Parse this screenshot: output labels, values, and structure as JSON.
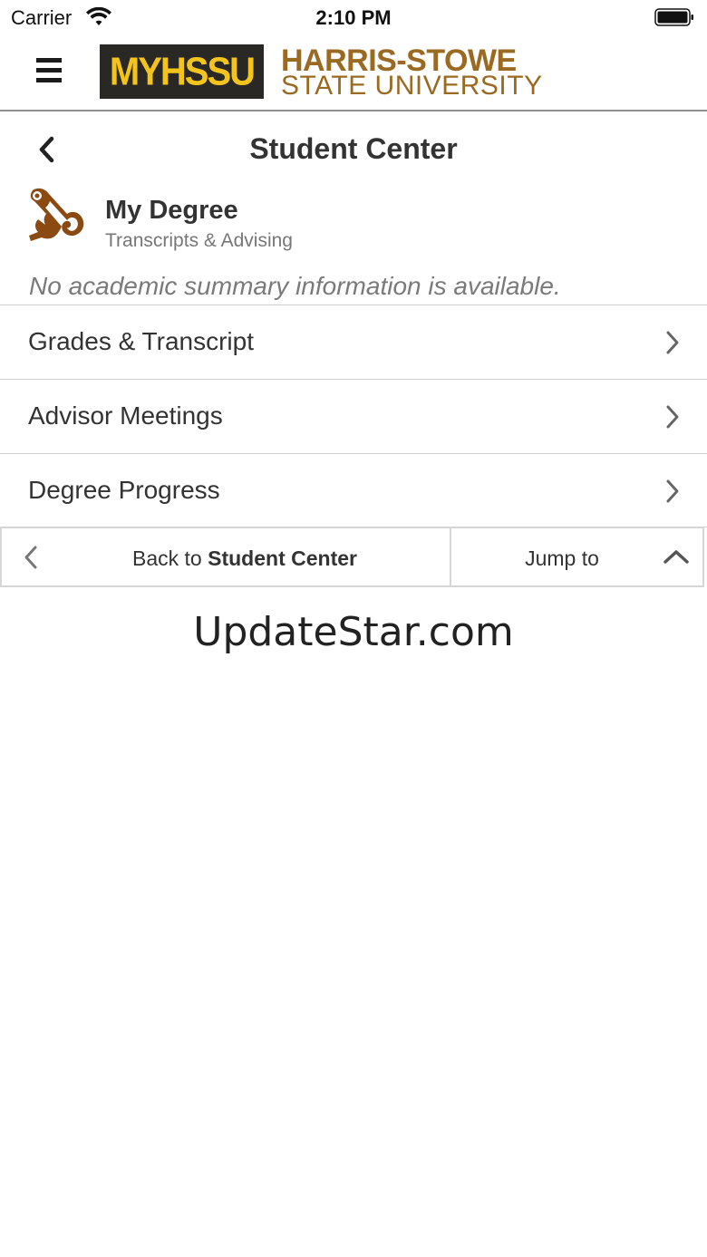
{
  "status_bar": {
    "carrier": "Carrier",
    "time": "2:10 PM",
    "icons": [
      "wifi-icon",
      "battery-icon"
    ]
  },
  "app_header": {
    "menu_icon": "hamburger-menu-icon",
    "logo_text": "MYHSSU",
    "university_line1": "HARRIS-STOWE",
    "university_line2": "STATE UNIVERSITY",
    "colors": {
      "logo_bg": "#2a2825",
      "logo_text": "#f3c41b",
      "university": "#9a6a22"
    }
  },
  "page": {
    "title": "Student Center",
    "back_icon": "chevron-left-icon"
  },
  "degree": {
    "icon": "diploma-scroll-icon",
    "title": "My Degree",
    "subtitle": "Transcripts & Advising",
    "summary_note": "No academic summary information is available."
  },
  "nav_items": [
    {
      "label": "Grades & Transcript"
    },
    {
      "label": "Advisor Meetings"
    },
    {
      "label": "Degree Progress"
    }
  ],
  "footer": {
    "back_prefix": "Back to",
    "back_target": "Student Center",
    "jump_label": "Jump to"
  },
  "watermark": "UpdateStar.com"
}
